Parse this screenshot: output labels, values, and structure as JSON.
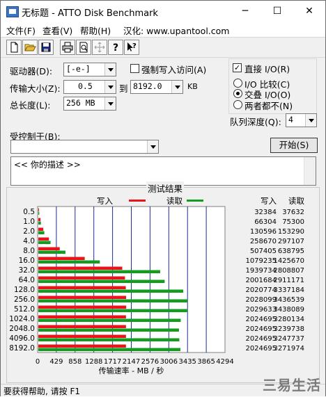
{
  "window": {
    "title": "无标题 - ATTO Disk Benchmark",
    "minimize_glyph": "─",
    "maximize_glyph": "☐",
    "close_glyph": "✕"
  },
  "menu": {
    "items": [
      "文件(F)",
      "查看(V)",
      "帮助(H)",
      "汉化: www.upantool.com"
    ]
  },
  "toolbar": {
    "icons": [
      "new-file-icon",
      "open-folder-icon",
      "save-icon",
      "print-icon",
      "print-preview-icon",
      "move-icon",
      "help-icon",
      "context-help-icon"
    ]
  },
  "form": {
    "drive_label": "驱动器(D):",
    "drive_value": "[-e-]",
    "force_write_label": "强制写入访问(A)",
    "transfer_label": "传输大小(Z):",
    "transfer_from": "0.5",
    "transfer_to_label": "到",
    "transfer_to": "8192.0",
    "transfer_unit": "KB",
    "total_label": "总长度(L):",
    "total_value": "256 MB",
    "direct_io_label": "直接 I/O(R)",
    "radio_compare": "I/O 比较(C)",
    "radio_overlap": "交叠 I/O(O)",
    "radio_neither": "两者都不(N)",
    "queue_label": "队列深度(Q):",
    "queue_value": "4",
    "controlled_label": "受控制于(B):",
    "controlled_value": "",
    "start_button": "开始(S)",
    "description": "<<  你的描述  >>"
  },
  "results": {
    "group_title": "测试结果",
    "legend_write": "写入",
    "legend_read": "读取",
    "col_write": "写入",
    "col_read": "读取",
    "x_axis_label": "传输速率 - MB / 秒"
  },
  "chart_data": {
    "type": "bar",
    "orientation": "horizontal",
    "categories": [
      "0.5",
      "1.0",
      "2.0",
      "4.0",
      "8.0",
      "16.0",
      "32.0",
      "64.0",
      "128.0",
      "256.0",
      "512.0",
      "1024.0",
      "2048.0",
      "4096.0",
      "8192.0"
    ],
    "series": [
      {
        "name": "写入",
        "color": "#e8141b",
        "values": [
          32384,
          66304,
          130596,
          258670,
          507405,
          1079235,
          1939734,
          2001684,
          2020774,
          2028099,
          2029633,
          2024695,
          2024695,
          2024695,
          2024695
        ]
      },
      {
        "name": "读取",
        "color": "#139d1e",
        "values": [
          37632,
          75300,
          153290,
          297107,
          638795,
          1425670,
          2808807,
          2911171,
          3337184,
          3436539,
          3438089,
          3280134,
          3239738,
          3247737,
          3271974
        ]
      }
    ],
    "x_ticks": [
      "0",
      "429",
      "858",
      "1288",
      "1717",
      "2147",
      "2576",
      "3006",
      "3435",
      "3865",
      "4294"
    ],
    "xlim": [
      0,
      4294
    ],
    "value_unit_scale": 1000,
    "xlabel": "传输速率 - MB / 秒",
    "grid": true,
    "legend": "top"
  },
  "status": {
    "text": "要获得帮助, 请按 F1",
    "watermark": "三易生活"
  }
}
